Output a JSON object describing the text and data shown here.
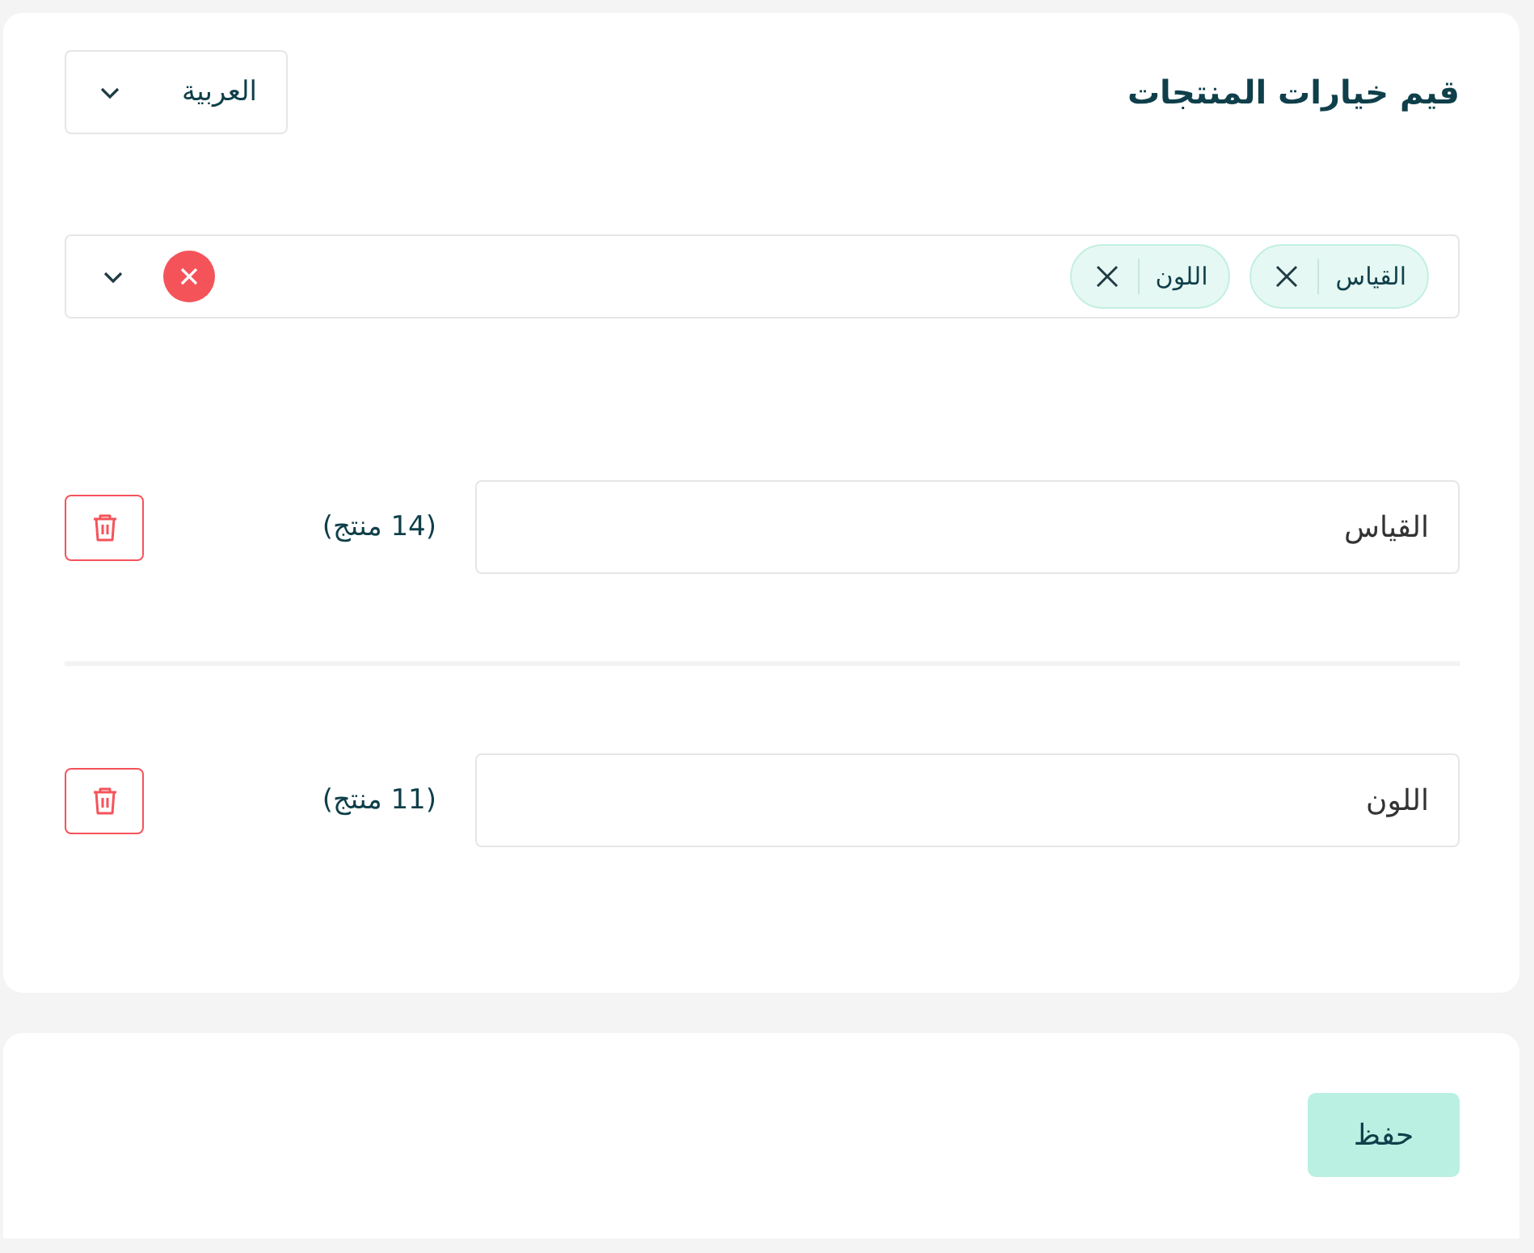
{
  "header": {
    "title": "قيم خيارات المنتجات",
    "language_select": {
      "value": "العربية"
    }
  },
  "option_picker": {
    "tags": [
      {
        "label": "القياس"
      },
      {
        "label": "اللون"
      }
    ]
  },
  "options": [
    {
      "value": "القياس",
      "count": "(14 منتج)"
    },
    {
      "value": "اللون",
      "count": "(11 منتج)"
    }
  ],
  "save_button": "حفظ"
}
